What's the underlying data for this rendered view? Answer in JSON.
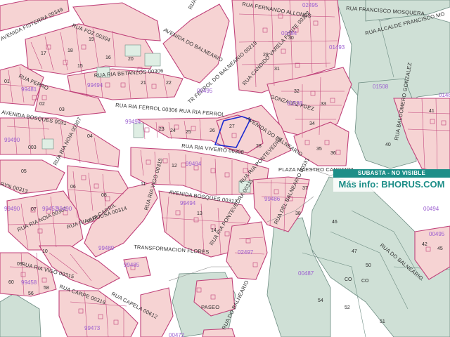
{
  "banner": {
    "title": "SUBASTA - NO VISIBLE",
    "info_prefix": "Más info: ",
    "info_site": "BHORUS.COM",
    "color": "#1d8e88"
  },
  "colors": {
    "block_fill": "#f6d3d3",
    "block_stroke": "#c0427a",
    "green_fill": "#cfe0d6",
    "green_stroke": "#6d8c82",
    "yard_fill": "#dfeee4",
    "label": "#2b2b2b",
    "parcel_code": "#9c5fd0",
    "highlight": "#1c2ad0"
  },
  "streets": [
    {
      "id": "avenida-fisterra",
      "text": "AVENIDA FISTERRA 00349"
    },
    {
      "id": "rua-foz",
      "text": "RUA FOZ 00304"
    },
    {
      "id": "avenida-do-balneario-n",
      "text": "AVENIDA DO BALNEARIO"
    },
    {
      "id": "rua-ferrol-n",
      "text": "RUA FERROL 00"
    },
    {
      "id": "tr-ferrol",
      "text": "TR FERROL DO BALNEARIO 00219"
    },
    {
      "id": "rua-betanzos",
      "text": "RUA RIA BETANZOS 00306"
    },
    {
      "id": "rua-ferro",
      "text": "RUA FERRO"
    },
    {
      "id": "rua-ria-ferrol",
      "text": "RUA RIA FERROL 00306  RUA RIA FERROL"
    },
    {
      "id": "avenida-bosques-w",
      "text": "AVENIDA BOSQUES 0031"
    },
    {
      "id": "rua-noia-n",
      "text": "RUA RIA NOIA 00307"
    },
    {
      "id": "rua-ria-viveiro",
      "text": "RUA RIA VIVEIRO 00308"
    },
    {
      "id": "av-balneario-mid",
      "text": "AVENIDA DO BALNEARIO"
    },
    {
      "id": "rua-candido",
      "text": "RUA CANDIDO VARELA FONTE 00322"
    },
    {
      "id": "rua-fernando",
      "text": "RUA FERNANDO ALLONES"
    },
    {
      "id": "rua-francisco",
      "text": "RUA FRANCISCO MOSQUERA"
    },
    {
      "id": "rua-alcalde",
      "text": "RUA ALCALDE FRANCISCO MO"
    },
    {
      "id": "gonzalez-fdez",
      "text": "GONZALEZ FDEZ"
    },
    {
      "id": "rua-baldomero",
      "text": "RUA BALDOMERO GONZALEZ"
    },
    {
      "id": "rua-pontevedra",
      "text": "RUA RIA PONTEVEDRA"
    },
    {
      "id": "avenida-bosques-s",
      "text": "AVENIDA BOSQUES 00312"
    },
    {
      "id": "rua-pontevedra-2",
      "text": "RUA RIA PONTEVEDRA 00311"
    },
    {
      "id": "plaza-maestro",
      "text": "PLAZA MAESTRO CANDEIRA"
    },
    {
      "id": "rua-del-balneario",
      "text": "RUA DEL BALNEARIO 00331"
    },
    {
      "id": "rua-do-balneario-s",
      "text": "RUA DO BALNEARIO"
    },
    {
      "id": "rua-arousa",
      "text": "RUA RIA AROUSA 00314"
    },
    {
      "id": "rua-noia-s",
      "text": "RUA RIA NOIA 00307"
    },
    {
      "id": "rua-vigo",
      "text": "RUA RIA VIGO 00315"
    },
    {
      "id": "rua-vigo-2",
      "text": "RUA RIA VIGO 00315"
    },
    {
      "id": "transformacion",
      "text": "TRANSFORMACION FLORES"
    },
    {
      "id": "rua-carril",
      "text": "RUA CARRIL"
    },
    {
      "id": "rua-carpe",
      "text": "RUA CARPE 00316"
    },
    {
      "id": "rua-capela",
      "text": "RUA CAPELA 00612"
    },
    {
      "id": "rua-ryn",
      "text": "RYN 00313"
    },
    {
      "id": "paseo",
      "text": "PASEO"
    },
    {
      "id": "rua-balneario-e",
      "text": "RUA DO BALNEARIO"
    }
  ],
  "parcel_codes": [
    "99481",
    "99490",
    "00495",
    "99494",
    "99494",
    "99494",
    "99490",
    "99490",
    "99494",
    "99489",
    "99486",
    "99485",
    "99473",
    "00472",
    "00487",
    "01508",
    "01480",
    "00484",
    "01493",
    "00494",
    "00495",
    "02497",
    "02495",
    "99452",
    "99458",
    "01538"
  ],
  "lots": [
    "01",
    "02",
    "03",
    "04",
    "05",
    "06",
    "07",
    "08",
    "09",
    "10",
    "11",
    "12",
    "13",
    "14",
    "15",
    "16",
    "17",
    "18",
    "19",
    "20",
    "21",
    "22",
    "23",
    "24",
    "25",
    "26",
    "27",
    "28",
    "29",
    "30",
    "31",
    "32",
    "33",
    "34",
    "35",
    "36",
    "37",
    "38",
    "40",
    "41",
    "42",
    "45",
    "46",
    "47",
    "50",
    "51",
    "52",
    "54",
    "56",
    "58",
    "60",
    "CO",
    "003",
    "CO"
  ]
}
